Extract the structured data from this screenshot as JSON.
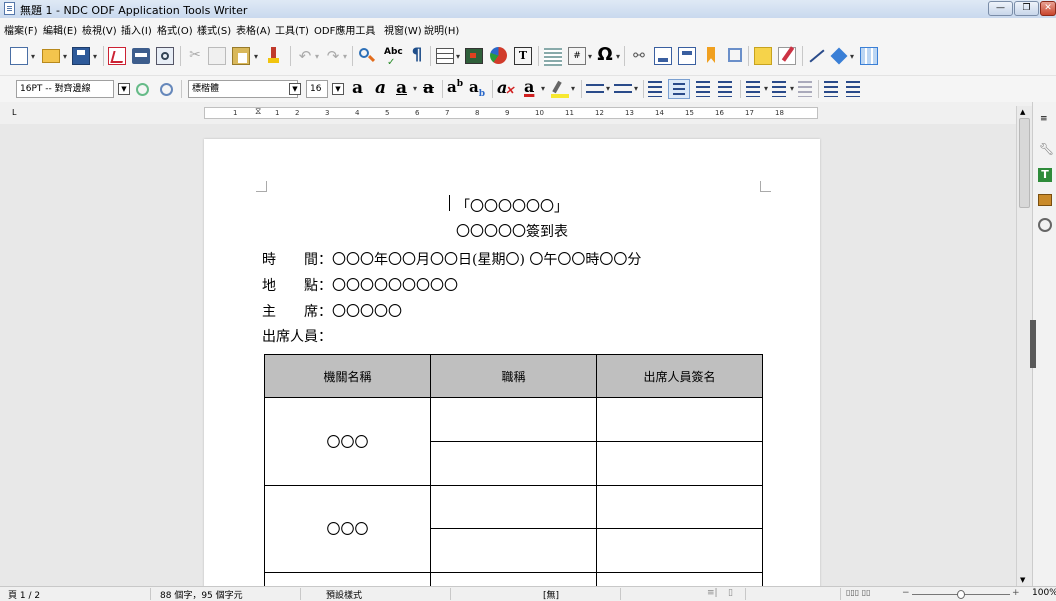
{
  "window": {
    "title": "無題 1 - NDC ODF Application Tools Writer"
  },
  "menu": [
    "檔案(F)",
    "編輯(E)",
    "檢視(V)",
    "插入(I)",
    "格式(O)",
    "樣式(S)",
    "表格(A)",
    "工具(T)",
    "ODF應用工具",
    "視窗(W)",
    "說明(H)"
  ],
  "format_toolbar": {
    "paragraph_style": "16PT -- 對齊邊線",
    "font_name": "標楷體",
    "font_size": "16"
  },
  "ruler": {
    "left_marker": "L",
    "numbers": [
      "1",
      "1",
      "2",
      "3",
      "4",
      "5",
      "6",
      "7",
      "8",
      "9",
      "10",
      "11",
      "12",
      "13",
      "14",
      "15",
      "16",
      "17",
      "18"
    ]
  },
  "document": {
    "title_line1": "「〇〇〇〇〇〇」",
    "title_line2": "〇〇〇〇〇簽到表",
    "time_label": "時　　間：",
    "time_value": "〇〇〇年〇〇月〇〇日(星期〇) 〇午〇〇時〇〇分",
    "place_label": "地　　點：",
    "place_value": "〇〇〇〇〇〇〇〇〇",
    "chair_label": "主　　席：",
    "chair_value": "〇〇〇〇〇",
    "attendees_label": "出席人員：",
    "table": {
      "headers": [
        "機關名稱",
        "職稱",
        "出席人員簽名"
      ],
      "org1": "〇〇〇",
      "org2": "〇〇〇"
    }
  },
  "statusbar": {
    "page": "頁 1 / 2",
    "words": "88 個字，95 個字元",
    "style": "預設樣式",
    "language": "[無]",
    "zoom": "100%"
  },
  "colors": {
    "table_header": "#bfbfbf",
    "title_bar": "#c9d9ee"
  }
}
